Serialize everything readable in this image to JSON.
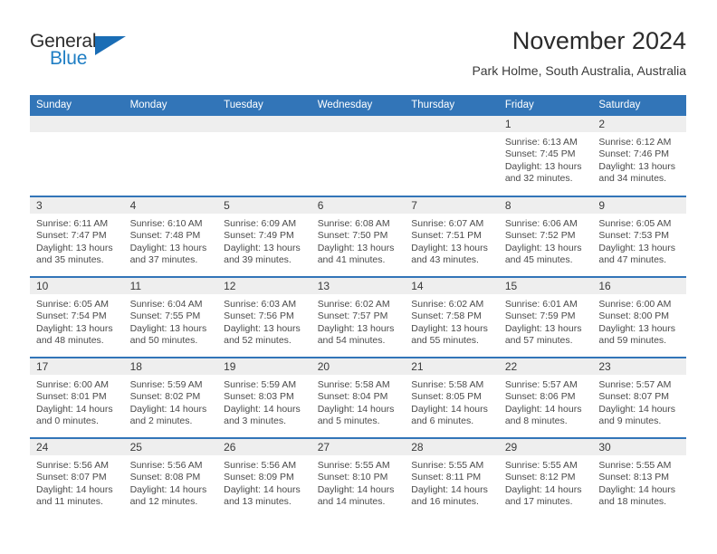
{
  "brand": {
    "name_part1": "General",
    "name_part2": "Blue",
    "logo_icon": "triangle-logo-icon",
    "accent_color": "#1a6db5"
  },
  "header": {
    "title": "November 2024",
    "subtitle": "Park Holme, South Australia, Australia"
  },
  "theme": {
    "header_blue": "#3275b8",
    "row_border_blue": "#3275b8",
    "daynum_band": "#eeeeee",
    "text": "#4a4a4a"
  },
  "calendar": {
    "weekday_headers": [
      "Sunday",
      "Monday",
      "Tuesday",
      "Wednesday",
      "Thursday",
      "Friday",
      "Saturday"
    ],
    "weeks": [
      [
        {
          "day": "",
          "empty": true,
          "sunrise": "",
          "sunset": "",
          "daylight_1": "",
          "daylight_2": ""
        },
        {
          "day": "",
          "empty": true,
          "sunrise": "",
          "sunset": "",
          "daylight_1": "",
          "daylight_2": ""
        },
        {
          "day": "",
          "empty": true,
          "sunrise": "",
          "sunset": "",
          "daylight_1": "",
          "daylight_2": ""
        },
        {
          "day": "",
          "empty": true,
          "sunrise": "",
          "sunset": "",
          "daylight_1": "",
          "daylight_2": ""
        },
        {
          "day": "",
          "empty": true,
          "sunrise": "",
          "sunset": "",
          "daylight_1": "",
          "daylight_2": ""
        },
        {
          "day": "1",
          "sunrise": "Sunrise: 6:13 AM",
          "sunset": "Sunset: 7:45 PM",
          "daylight_1": "Daylight: 13 hours",
          "daylight_2": "and 32 minutes."
        },
        {
          "day": "2",
          "sunrise": "Sunrise: 6:12 AM",
          "sunset": "Sunset: 7:46 PM",
          "daylight_1": "Daylight: 13 hours",
          "daylight_2": "and 34 minutes."
        }
      ],
      [
        {
          "day": "3",
          "sunrise": "Sunrise: 6:11 AM",
          "sunset": "Sunset: 7:47 PM",
          "daylight_1": "Daylight: 13 hours",
          "daylight_2": "and 35 minutes."
        },
        {
          "day": "4",
          "sunrise": "Sunrise: 6:10 AM",
          "sunset": "Sunset: 7:48 PM",
          "daylight_1": "Daylight: 13 hours",
          "daylight_2": "and 37 minutes."
        },
        {
          "day": "5",
          "sunrise": "Sunrise: 6:09 AM",
          "sunset": "Sunset: 7:49 PM",
          "daylight_1": "Daylight: 13 hours",
          "daylight_2": "and 39 minutes."
        },
        {
          "day": "6",
          "sunrise": "Sunrise: 6:08 AM",
          "sunset": "Sunset: 7:50 PM",
          "daylight_1": "Daylight: 13 hours",
          "daylight_2": "and 41 minutes."
        },
        {
          "day": "7",
          "sunrise": "Sunrise: 6:07 AM",
          "sunset": "Sunset: 7:51 PM",
          "daylight_1": "Daylight: 13 hours",
          "daylight_2": "and 43 minutes."
        },
        {
          "day": "8",
          "sunrise": "Sunrise: 6:06 AM",
          "sunset": "Sunset: 7:52 PM",
          "daylight_1": "Daylight: 13 hours",
          "daylight_2": "and 45 minutes."
        },
        {
          "day": "9",
          "sunrise": "Sunrise: 6:05 AM",
          "sunset": "Sunset: 7:53 PM",
          "daylight_1": "Daylight: 13 hours",
          "daylight_2": "and 47 minutes."
        }
      ],
      [
        {
          "day": "10",
          "sunrise": "Sunrise: 6:05 AM",
          "sunset": "Sunset: 7:54 PM",
          "daylight_1": "Daylight: 13 hours",
          "daylight_2": "and 48 minutes."
        },
        {
          "day": "11",
          "sunrise": "Sunrise: 6:04 AM",
          "sunset": "Sunset: 7:55 PM",
          "daylight_1": "Daylight: 13 hours",
          "daylight_2": "and 50 minutes."
        },
        {
          "day": "12",
          "sunrise": "Sunrise: 6:03 AM",
          "sunset": "Sunset: 7:56 PM",
          "daylight_1": "Daylight: 13 hours",
          "daylight_2": "and 52 minutes."
        },
        {
          "day": "13",
          "sunrise": "Sunrise: 6:02 AM",
          "sunset": "Sunset: 7:57 PM",
          "daylight_1": "Daylight: 13 hours",
          "daylight_2": "and 54 minutes."
        },
        {
          "day": "14",
          "sunrise": "Sunrise: 6:02 AM",
          "sunset": "Sunset: 7:58 PM",
          "daylight_1": "Daylight: 13 hours",
          "daylight_2": "and 55 minutes."
        },
        {
          "day": "15",
          "sunrise": "Sunrise: 6:01 AM",
          "sunset": "Sunset: 7:59 PM",
          "daylight_1": "Daylight: 13 hours",
          "daylight_2": "and 57 minutes."
        },
        {
          "day": "16",
          "sunrise": "Sunrise: 6:00 AM",
          "sunset": "Sunset: 8:00 PM",
          "daylight_1": "Daylight: 13 hours",
          "daylight_2": "and 59 minutes."
        }
      ],
      [
        {
          "day": "17",
          "sunrise": "Sunrise: 6:00 AM",
          "sunset": "Sunset: 8:01 PM",
          "daylight_1": "Daylight: 14 hours",
          "daylight_2": "and 0 minutes."
        },
        {
          "day": "18",
          "sunrise": "Sunrise: 5:59 AM",
          "sunset": "Sunset: 8:02 PM",
          "daylight_1": "Daylight: 14 hours",
          "daylight_2": "and 2 minutes."
        },
        {
          "day": "19",
          "sunrise": "Sunrise: 5:59 AM",
          "sunset": "Sunset: 8:03 PM",
          "daylight_1": "Daylight: 14 hours",
          "daylight_2": "and 3 minutes."
        },
        {
          "day": "20",
          "sunrise": "Sunrise: 5:58 AM",
          "sunset": "Sunset: 8:04 PM",
          "daylight_1": "Daylight: 14 hours",
          "daylight_2": "and 5 minutes."
        },
        {
          "day": "21",
          "sunrise": "Sunrise: 5:58 AM",
          "sunset": "Sunset: 8:05 PM",
          "daylight_1": "Daylight: 14 hours",
          "daylight_2": "and 6 minutes."
        },
        {
          "day": "22",
          "sunrise": "Sunrise: 5:57 AM",
          "sunset": "Sunset: 8:06 PM",
          "daylight_1": "Daylight: 14 hours",
          "daylight_2": "and 8 minutes."
        },
        {
          "day": "23",
          "sunrise": "Sunrise: 5:57 AM",
          "sunset": "Sunset: 8:07 PM",
          "daylight_1": "Daylight: 14 hours",
          "daylight_2": "and 9 minutes."
        }
      ],
      [
        {
          "day": "24",
          "sunrise": "Sunrise: 5:56 AM",
          "sunset": "Sunset: 8:07 PM",
          "daylight_1": "Daylight: 14 hours",
          "daylight_2": "and 11 minutes."
        },
        {
          "day": "25",
          "sunrise": "Sunrise: 5:56 AM",
          "sunset": "Sunset: 8:08 PM",
          "daylight_1": "Daylight: 14 hours",
          "daylight_2": "and 12 minutes."
        },
        {
          "day": "26",
          "sunrise": "Sunrise: 5:56 AM",
          "sunset": "Sunset: 8:09 PM",
          "daylight_1": "Daylight: 14 hours",
          "daylight_2": "and 13 minutes."
        },
        {
          "day": "27",
          "sunrise": "Sunrise: 5:55 AM",
          "sunset": "Sunset: 8:10 PM",
          "daylight_1": "Daylight: 14 hours",
          "daylight_2": "and 14 minutes."
        },
        {
          "day": "28",
          "sunrise": "Sunrise: 5:55 AM",
          "sunset": "Sunset: 8:11 PM",
          "daylight_1": "Daylight: 14 hours",
          "daylight_2": "and 16 minutes."
        },
        {
          "day": "29",
          "sunrise": "Sunrise: 5:55 AM",
          "sunset": "Sunset: 8:12 PM",
          "daylight_1": "Daylight: 14 hours",
          "daylight_2": "and 17 minutes."
        },
        {
          "day": "30",
          "sunrise": "Sunrise: 5:55 AM",
          "sunset": "Sunset: 8:13 PM",
          "daylight_1": "Daylight: 14 hours",
          "daylight_2": "and 18 minutes."
        }
      ]
    ]
  }
}
